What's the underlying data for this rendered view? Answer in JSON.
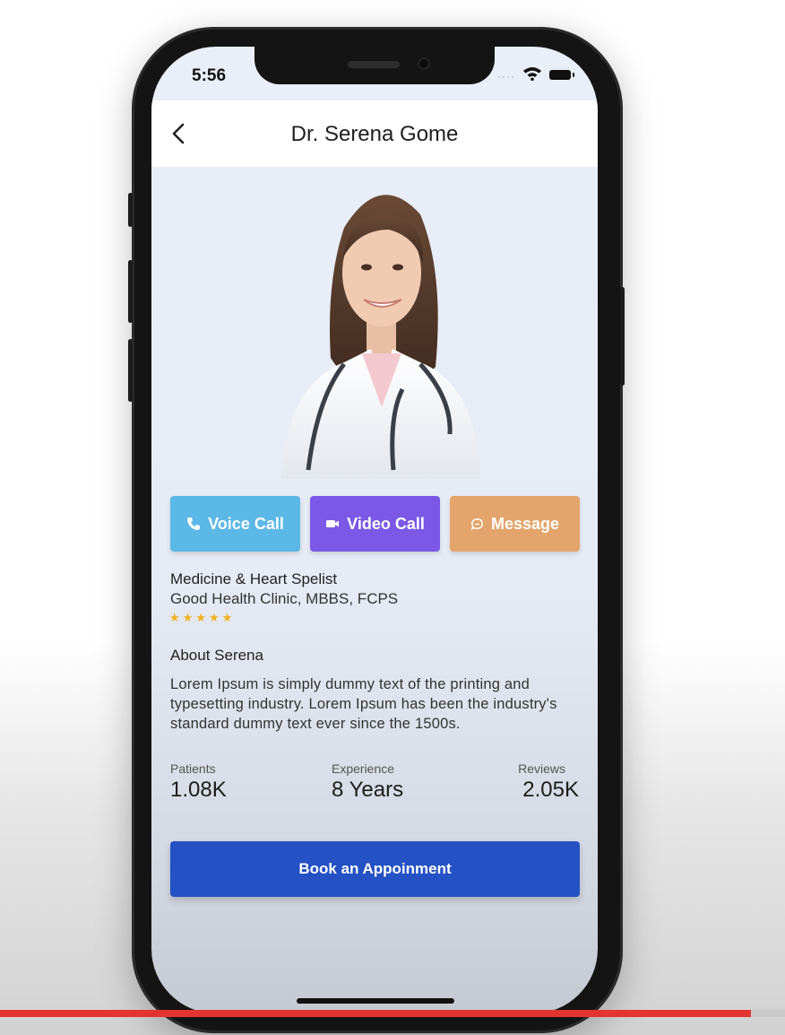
{
  "status": {
    "time": "5:56"
  },
  "header": {
    "title": "Dr. Serena Gome"
  },
  "actions": [
    {
      "label": "Voice Call",
      "icon": "phone-icon",
      "color": "#5cb8e6"
    },
    {
      "label": "Video Call",
      "icon": "video-camera-icon",
      "color": "#7b58e6"
    },
    {
      "label": "Message",
      "icon": "message-bubble-icon",
      "color": "#e3a56b"
    }
  ],
  "doctor": {
    "specialty": "Medicine & Heart Spelist",
    "clinic": "Good Health Clinic, MBBS, FCPS",
    "rating": 5,
    "rating_display": "★★★★★"
  },
  "about": {
    "title": "About Serena",
    "text": "Lorem Ipsum is simply dummy text of the printing and typesetting industry. Lorem Ipsum has been the industry's standard dummy text ever since the 1500s."
  },
  "stats": [
    {
      "label": "Patients",
      "value": "1.08K"
    },
    {
      "label": "Experience",
      "value": "8 Years"
    },
    {
      "label": "Reviews",
      "value": "2.05K"
    }
  ],
  "book_button": {
    "label": "Book an Appoinment",
    "color": "#2451c4"
  },
  "video_progress": {
    "fraction": 0.957
  }
}
